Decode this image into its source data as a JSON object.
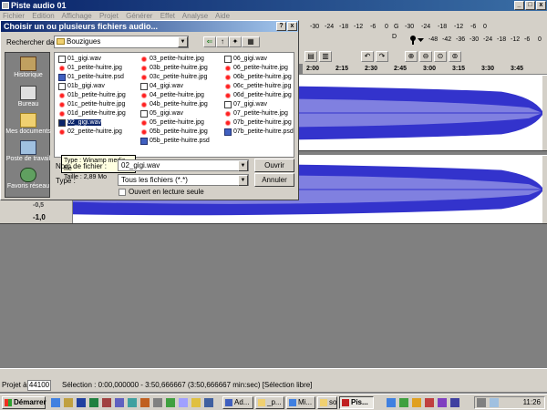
{
  "app": {
    "title": "Piste audio 01",
    "menus": [
      "Fichier",
      "Edition",
      "Affichage",
      "Projet",
      "Générer",
      "Effet",
      "Analyse",
      "Aide"
    ],
    "meter_ticks_in": [
      "-30",
      "-24",
      "-18",
      "-12",
      "-6",
      "0"
    ],
    "meter_ticks_out": [
      "-48",
      "-42",
      "-36",
      "-30",
      "-24",
      "-18",
      "-12",
      "-6",
      "0"
    ],
    "meter_g": "G",
    "meter_d": "D",
    "ruler_marks": [
      "2:00",
      "2:15",
      "2:30",
      "2:45",
      "3:00",
      "3:15",
      "3:30",
      "3:45"
    ],
    "scale_label": "-1,0",
    "scale_label_2": "-0,5"
  },
  "dialog": {
    "title": "Choisir un ou plusieurs fichiers audio...",
    "help": "?",
    "close": "x",
    "look_in_label": "Rechercher dans :",
    "look_in_value": "Bouzigues",
    "places": [
      {
        "label": "Historique",
        "icon": "history-icon"
      },
      {
        "label": "Bureau",
        "icon": "desktop-icon"
      },
      {
        "label": "Mes documents",
        "icon": "my-documents-icon"
      },
      {
        "label": "Poste de travail",
        "icon": "my-computer-icon"
      },
      {
        "label": "Favoris réseau",
        "icon": "network-places-icon"
      }
    ],
    "files": [
      {
        "name": "01_gigi.wav",
        "type": "wav"
      },
      {
        "name": "01_petite-huitre.jpg",
        "type": "img"
      },
      {
        "name": "01_petite-huitre.psd",
        "type": "psd"
      },
      {
        "name": "01b_gigi.wav",
        "type": "wav"
      },
      {
        "name": "01b_petite-huitre.jpg",
        "type": "img"
      },
      {
        "name": "01c_petite-huitre.jpg",
        "type": "img"
      },
      {
        "name": "01d_petite-huitre.jpg",
        "type": "img"
      },
      {
        "name": "02_gigi.wav",
        "type": "wav",
        "selected": true
      },
      {
        "name": "02_petite-huitre.jpg",
        "type": "img"
      },
      {
        "name": "03_petite-huitre.jpg",
        "type": "img"
      },
      {
        "name": "03b_petite-huitre.jpg",
        "type": "img"
      },
      {
        "name": "03c_petite-huitre.jpg",
        "type": "img"
      },
      {
        "name": "04_gigi.wav",
        "type": "wav"
      },
      {
        "name": "04_petite-huitre.jpg",
        "type": "img"
      },
      {
        "name": "04b_petite-huitre.jpg",
        "type": "img"
      },
      {
        "name": "05_gigi.wav",
        "type": "wav"
      },
      {
        "name": "05_petite-huitre.jpg",
        "type": "img"
      },
      {
        "name": "05b_petite-huitre.jpg",
        "type": "img"
      },
      {
        "name": "05b_petite-huitre.psd",
        "type": "psd"
      },
      {
        "name": "06_gigi.wav",
        "type": "wav"
      },
      {
        "name": "06_petite-huitre.jpg",
        "type": "img"
      },
      {
        "name": "06b_petite-huitre.jpg",
        "type": "img"
      },
      {
        "name": "06c_petite-huitre.jpg",
        "type": "img"
      },
      {
        "name": "06d_petite-huitre.jpg",
        "type": "img"
      },
      {
        "name": "07_gigi.wav",
        "type": "wav"
      },
      {
        "name": "07_petite-huitre.jpg",
        "type": "img"
      },
      {
        "name": "07b_petite-huitre.jpg",
        "type": "img"
      },
      {
        "name": "07b_petite-huitre.psd",
        "type": "psd"
      }
    ],
    "tooltip_line1": "Type : Winamp media file",
    "tooltip_line2": "Taille : 2,89 Mo",
    "filename_label": "Nom de fichier :",
    "filename_value": "02_gigi.wav",
    "filetype_label": "Type :",
    "filetype_value": "Tous les fichiers (*.*)",
    "readonly_label": "Ouvert en lecture seule",
    "open_button": "Ouvrir",
    "cancel_button": "Annuler"
  },
  "status": {
    "project_label": "Projet à :",
    "project_rate": "44100",
    "selection": "Sélection : 0:00,000000 - 3:50,666667 (3:50,666667 min:sec)  [Sélection libre]"
  },
  "taskbar": {
    "start": "Démarrer",
    "tasks": [
      {
        "label": "Ad...",
        "active": false
      },
      {
        "label": "_p...",
        "active": false
      },
      {
        "label": "Mi...",
        "active": false
      },
      {
        "label": "son",
        "active": false
      },
      {
        "label": "Pis...",
        "active": true
      }
    ],
    "clock": "11:26"
  },
  "colors": {
    "title_blue": "#0a246a",
    "wave_blue": "#3333cc",
    "wave_light": "#8080e0",
    "chrome": "#d4d0c8"
  }
}
